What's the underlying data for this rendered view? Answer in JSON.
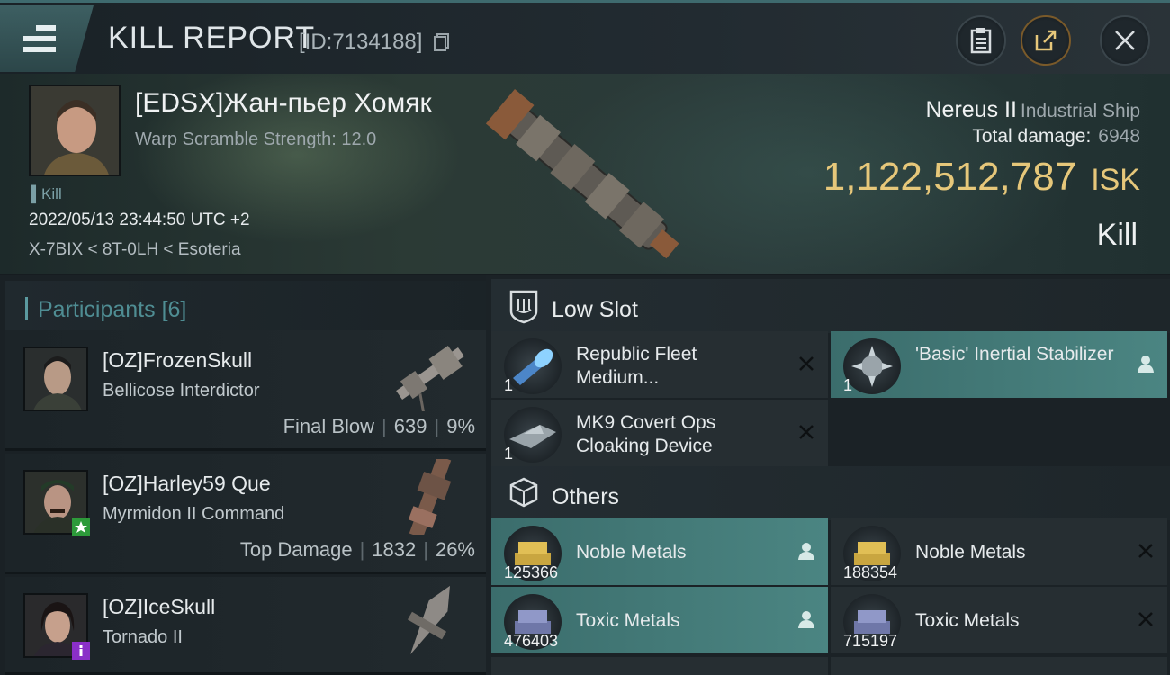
{
  "header": {
    "title": "KILL REPORT",
    "report_id": "[ID:7134188]",
    "buttons": [
      "clipboard-icon",
      "share-icon",
      "close-icon"
    ]
  },
  "victim": {
    "pilot_name": "[EDSX]Жан-пьер Хомяк",
    "warp_scramble": "Warp Scramble Strength: 12.0",
    "kill_tag": "Kill",
    "time": "2022/05/13 23:44:50 UTC +2",
    "location": "X-7BIX < 8T-0LH < Esoteria",
    "ship_name": "Nereus II",
    "ship_class": "Industrial Ship",
    "total_damage_label": "Total damage:",
    "total_damage": "6948",
    "isk_value": "1,122,512,787",
    "isk_unit": "ISK",
    "result": "Kill"
  },
  "participants": {
    "label": "Participants",
    "count": "[6]",
    "rows": [
      {
        "name": "[OZ]FrozenSkull",
        "ship": "Bellicose Interdictor",
        "role": "Final Blow",
        "damage": "639",
        "percent": "9%",
        "badge": ""
      },
      {
        "name": "[OZ]Harley59 Que",
        "ship": "Myrmidon II Command",
        "role": "Top Damage",
        "damage": "1832",
        "percent": "26%",
        "badge": "star-badge-icon"
      },
      {
        "name": "[OZ]IceSkull",
        "ship": "Tornado II",
        "role": "",
        "damage": "",
        "percent": "",
        "badge": "info-badge-icon"
      }
    ]
  },
  "low_slot": {
    "label": "Low Slot",
    "items": [
      {
        "name": "Republic Fleet Medium...",
        "qty": "1",
        "status": "destroyed",
        "icon": "module-icon"
      },
      {
        "name": "'Basic' Inertial Stabilizer",
        "qty": "1",
        "status": "dropped",
        "icon": "module-icon"
      },
      {
        "name": "MK9 Covert Ops Cloaking Device",
        "qty": "1",
        "status": "destroyed",
        "icon": "module-icon"
      }
    ]
  },
  "others": {
    "label": "Others",
    "items": [
      {
        "name": "Noble Metals",
        "qty": "125366",
        "status": "dropped",
        "icon": "ore-icon"
      },
      {
        "name": "Noble Metals",
        "qty": "188354",
        "status": "destroyed",
        "icon": "ore-icon"
      },
      {
        "name": "Toxic Metals",
        "qty": "476403",
        "status": "dropped",
        "icon": "ore-icon"
      },
      {
        "name": "Toxic Metals",
        "qty": "715197",
        "status": "destroyed",
        "icon": "ore-icon"
      }
    ]
  },
  "colors": {
    "accent": "#4b8582",
    "isk": "#e6c77a",
    "participants_label": "#4f8d93"
  }
}
